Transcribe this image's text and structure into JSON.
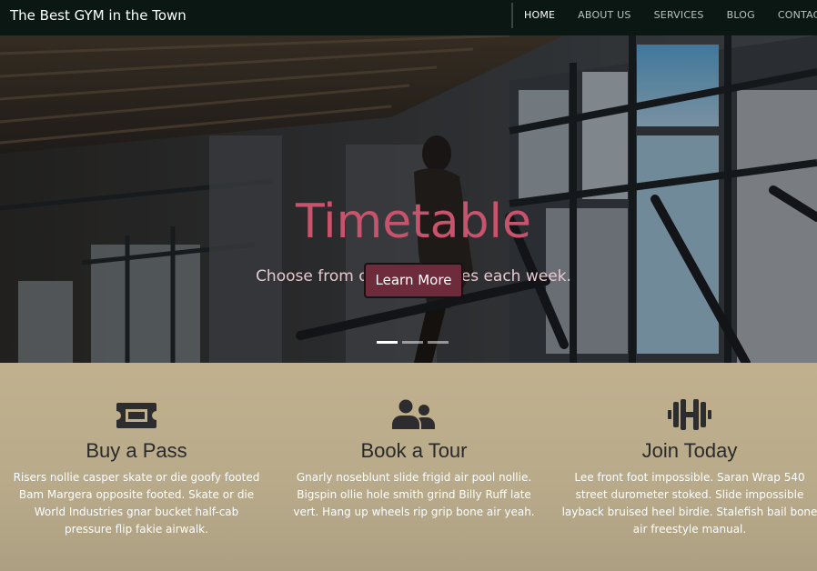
{
  "brand": "The Best GYM in the Town",
  "nav": {
    "items": [
      "HOME",
      "ABOUT US",
      "SERVICES",
      "BLOG",
      "CONTACT"
    ],
    "active": "HOME"
  },
  "hero": {
    "title": "Timetable",
    "subtitle": "Choose from over 80 classes each week.",
    "button": "Learn More",
    "slide_count": 3,
    "active_slide": 1
  },
  "features": [
    {
      "icon": "ticket-icon",
      "title": "Buy a Pass",
      "text": "Risers nollie casper skate or die goofy footed Bam Margera opposite footed. Skate or die World Industries gnar bucket half-cab pressure flip fakie airwalk."
    },
    {
      "icon": "users-icon",
      "title": "Book a Tour",
      "text": "Gnarly noseblunt slide frigid air pool nollie. Bigspin ollie hole smith grind Billy Ruff late vert. Hang up wheels rip grip bone air yeah."
    },
    {
      "icon": "dumbbell-icon",
      "title": "Join Today",
      "text": "Lee front foot impossible. Saran Wrap 540 street durometer stoked. Slide impossible layback bruised heel birdie. Stalefish bail bone air freestyle manual."
    }
  ],
  "colors": {
    "navbar": "#0b1712",
    "hero_title": "#c8536d",
    "button": "#6d2b3c",
    "features_bg": "#b8ab88"
  }
}
